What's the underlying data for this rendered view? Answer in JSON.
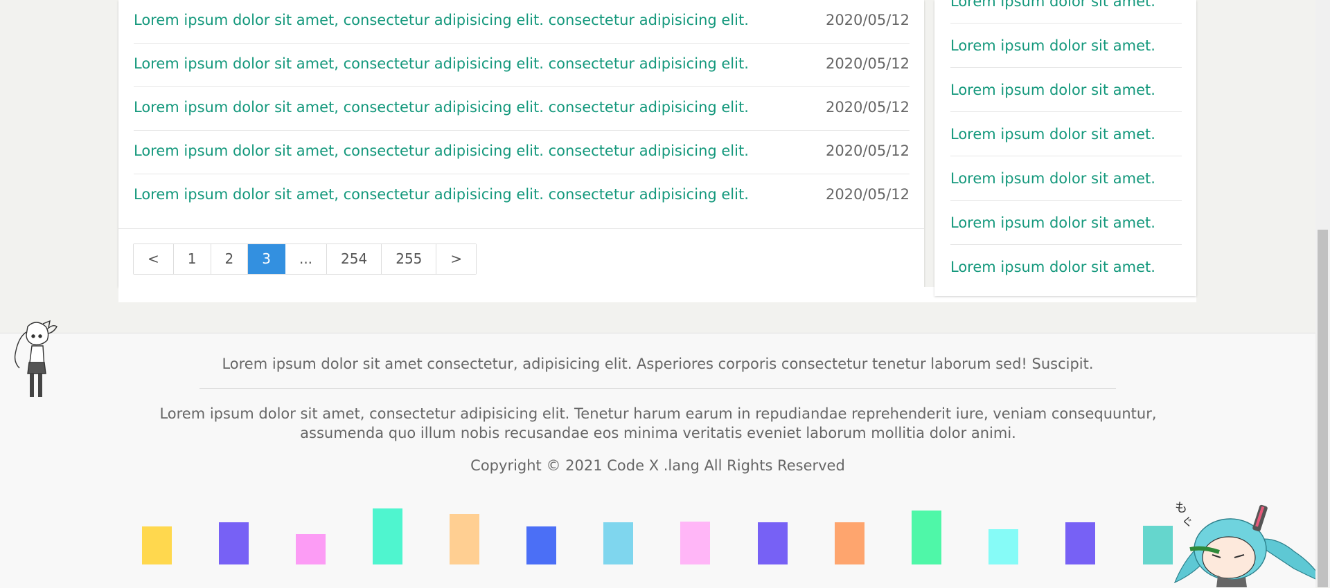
{
  "articles": [
    {
      "title": "Lorem ipsum dolor sit amet, consectetur adipisicing elit. consectetur adipisicing elit.",
      "date": "2020/05/12"
    },
    {
      "title": "Lorem ipsum dolor sit amet, consectetur adipisicing elit. consectetur adipisicing elit.",
      "date": "2020/05/12"
    },
    {
      "title": "Lorem ipsum dolor sit amet, consectetur adipisicing elit. consectetur adipisicing elit.",
      "date": "2020/05/12"
    },
    {
      "title": "Lorem ipsum dolor sit amet, consectetur adipisicing elit. consectetur adipisicing elit.",
      "date": "2020/05/12"
    },
    {
      "title": "Lorem ipsum dolor sit amet, consectetur adipisicing elit. consectetur adipisicing elit.",
      "date": "2020/05/12"
    }
  ],
  "pagination": {
    "prev": "<",
    "pages": [
      "1",
      "2",
      "3",
      "...",
      "254",
      "255"
    ],
    "current": "3",
    "next": ">",
    "active_color": "#3390e0"
  },
  "sidebar": {
    "links": [
      "Lorem ipsum dolor sit amet.",
      "Lorem ipsum dolor sit amet.",
      "Lorem ipsum dolor sit amet.",
      "Lorem ipsum dolor sit amet.",
      "Lorem ipsum dolor sit amet.",
      "Lorem ipsum dolor sit amet.",
      "Lorem ipsum dolor sit amet."
    ]
  },
  "footer": {
    "line1": "Lorem ipsum dolor sit amet consectetur, adipisicing elit. Asperiores corporis consectetur tenetur laborum sed! Suscipit.",
    "line2": "Lorem ipsum dolor sit amet, consectetur adipisicing elit. Tenetur harum earum in repudiandae reprehenderit iure, veniam consequuntur, assumenda quo illum nobis recusandae eos minima veritatis eveniet laborum mollitia dolor animi.",
    "copyright": "Copyright © 2021 Code X .lang All Rights Reserved",
    "bar_colors": [
      "#ffd84e",
      "#7761f5",
      "#fc9cf5",
      "#4ff5cf",
      "#ffcf92",
      "#4b6ff6",
      "#7fd6ee",
      "#ffb6f7",
      "#7761f5",
      "#fea56e",
      "#4ff7a8",
      "#86fbf7",
      "#7761f5",
      "#65d6cd"
    ]
  },
  "colors": {
    "link": "#14987c",
    "date": "#666666",
    "background": "#f2f2ef"
  },
  "decorations": [
    "anime-girl-mascot-icon",
    "chibi-miku-mascot-icon"
  ]
}
